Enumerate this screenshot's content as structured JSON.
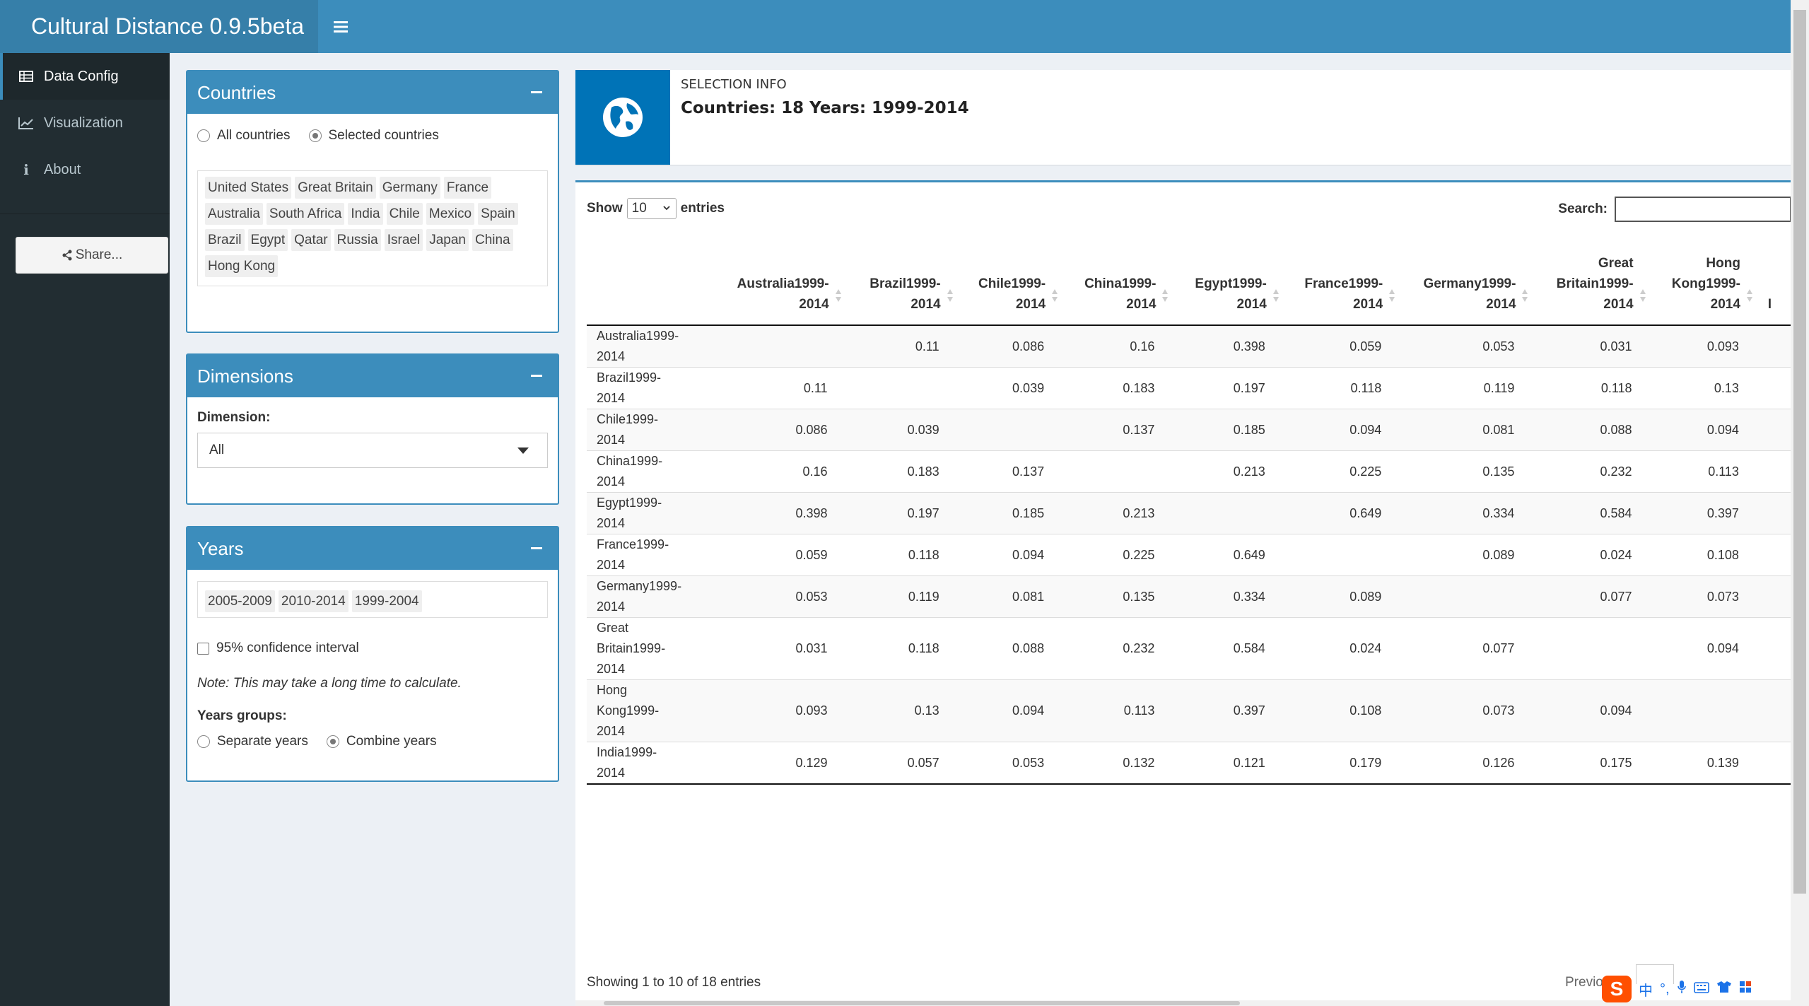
{
  "app": {
    "title": "Cultural Distance 0.9.5beta",
    "accent": "#3c8dbc",
    "logo_bg": "#367fa9",
    "sidebar_bg": "#222d32"
  },
  "sidebar": {
    "items": [
      {
        "label": "Data Config",
        "icon": "table-icon",
        "active": true
      },
      {
        "label": "Visualization",
        "icon": "line-chart-icon",
        "active": false
      },
      {
        "label": "About",
        "icon": "info-icon",
        "active": false
      }
    ],
    "share_label": "Share..."
  },
  "countries_box": {
    "title": "Countries",
    "radio_all": "All countries",
    "radio_selected": "Selected countries",
    "selected_option": "Selected countries",
    "tags": [
      "United States",
      "Great Britain",
      "Germany",
      "France",
      "Australia",
      "South Africa",
      "India",
      "Chile",
      "Mexico",
      "Spain",
      "Brazil",
      "Egypt",
      "Qatar",
      "Russia",
      "Israel",
      "Japan",
      "China",
      "Hong Kong"
    ]
  },
  "dimensions_box": {
    "title": "Dimensions",
    "label": "Dimension:",
    "value": "All"
  },
  "years_box": {
    "title": "Years",
    "tags": [
      "2005-2009",
      "2010-2014",
      "1999-2004"
    ],
    "ci_label": "95% confidence interval",
    "ci_checked": false,
    "note": "Note: This may take a long time to calculate.",
    "groups_label": "Years groups:",
    "radio_separate": "Separate years",
    "radio_combine": "Combine years",
    "selected_group": "Combine years"
  },
  "info": {
    "label": "SELECTION INFO",
    "value": "Countries: 18 Years: 1999-2014",
    "icon": "globe-icon"
  },
  "table": {
    "show_label": "Show",
    "entries_label": "entries",
    "page_length": "10",
    "search_label": "Search:",
    "columns": [
      "",
      "Australia1999-2014",
      "Brazil1999-2014",
      "Chile1999-2014",
      "China1999-2014",
      "Egypt1999-2014",
      "France1999-2014",
      "Germany1999-2014",
      "Great Britain1999-2014",
      "Hong Kong1999-2014",
      "I"
    ],
    "rows": [
      [
        "Australia1999-2014",
        "",
        "0.11",
        "0.086",
        "0.16",
        "0.398",
        "0.059",
        "0.053",
        "0.031",
        "0.093"
      ],
      [
        "Brazil1999-2014",
        "0.11",
        "",
        "0.039",
        "0.183",
        "0.197",
        "0.118",
        "0.119",
        "0.118",
        "0.13"
      ],
      [
        "Chile1999-2014",
        "0.086",
        "0.039",
        "",
        "0.137",
        "0.185",
        "0.094",
        "0.081",
        "0.088",
        "0.094"
      ],
      [
        "China1999-2014",
        "0.16",
        "0.183",
        "0.137",
        "",
        "0.213",
        "0.225",
        "0.135",
        "0.232",
        "0.113"
      ],
      [
        "Egypt1999-2014",
        "0.398",
        "0.197",
        "0.185",
        "0.213",
        "",
        "0.649",
        "0.334",
        "0.584",
        "0.397"
      ],
      [
        "France1999-2014",
        "0.059",
        "0.118",
        "0.094",
        "0.225",
        "0.649",
        "",
        "0.089",
        "0.024",
        "0.108"
      ],
      [
        "Germany1999-2014",
        "0.053",
        "0.119",
        "0.081",
        "0.135",
        "0.334",
        "0.089",
        "",
        "0.077",
        "0.073"
      ],
      [
        "Great Britain1999-2014",
        "0.031",
        "0.118",
        "0.088",
        "0.232",
        "0.584",
        "0.024",
        "0.077",
        "",
        "0.094"
      ],
      [
        "Hong Kong1999-2014",
        "0.093",
        "0.13",
        "0.094",
        "0.113",
        "0.397",
        "0.108",
        "0.073",
        "0.094",
        ""
      ],
      [
        "India1999-2014",
        "0.129",
        "0.057",
        "0.053",
        "0.132",
        "0.121",
        "0.179",
        "0.126",
        "0.175",
        "0.139"
      ]
    ],
    "footer_info": "Showing 1 to 10 of 18 entries",
    "previous_label": "Previo"
  },
  "ime_bar": {
    "logo": "S",
    "lang": "中"
  }
}
